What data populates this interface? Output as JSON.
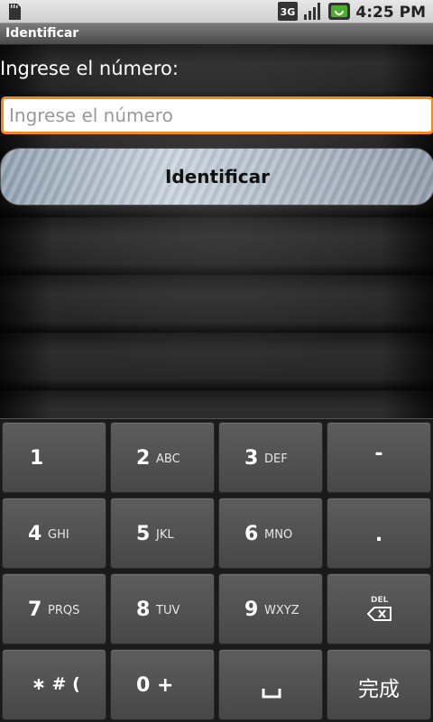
{
  "status_bar": {
    "time": "4:25 PM",
    "network_label": "3G",
    "icons": [
      "sd-card-icon",
      "network-3g-icon",
      "signal-icon",
      "battery-icon"
    ]
  },
  "title_bar": {
    "title": "Identificar"
  },
  "form": {
    "label": "Ingrese el número:",
    "input_placeholder": "Ingrese el número",
    "input_value": "",
    "button_label": "Identificar"
  },
  "keyboard": {
    "keys": [
      {
        "main": "1",
        "sub": ""
      },
      {
        "main": "2",
        "sub": "ABC"
      },
      {
        "main": "3",
        "sub": "DEF"
      },
      {
        "main": "-",
        "sub": ""
      },
      {
        "main": "4",
        "sub": "GHI"
      },
      {
        "main": "5",
        "sub": "JKL"
      },
      {
        "main": "6",
        "sub": "MNO"
      },
      {
        "main": ".",
        "sub": ""
      },
      {
        "main": "7",
        "sub": "PRQS"
      },
      {
        "main": "8",
        "sub": "TUV"
      },
      {
        "main": "9",
        "sub": "WXYZ"
      },
      {
        "main": "",
        "sub": "DEL"
      },
      {
        "main": "∗ # (",
        "sub": ""
      },
      {
        "main": "0 +",
        "sub": ""
      },
      {
        "main": "␣",
        "sub": ""
      },
      {
        "main": "完成",
        "sub": ""
      }
    ]
  },
  "colors": {
    "focus_border": "#f08a1c",
    "key_face": "#555555"
  }
}
